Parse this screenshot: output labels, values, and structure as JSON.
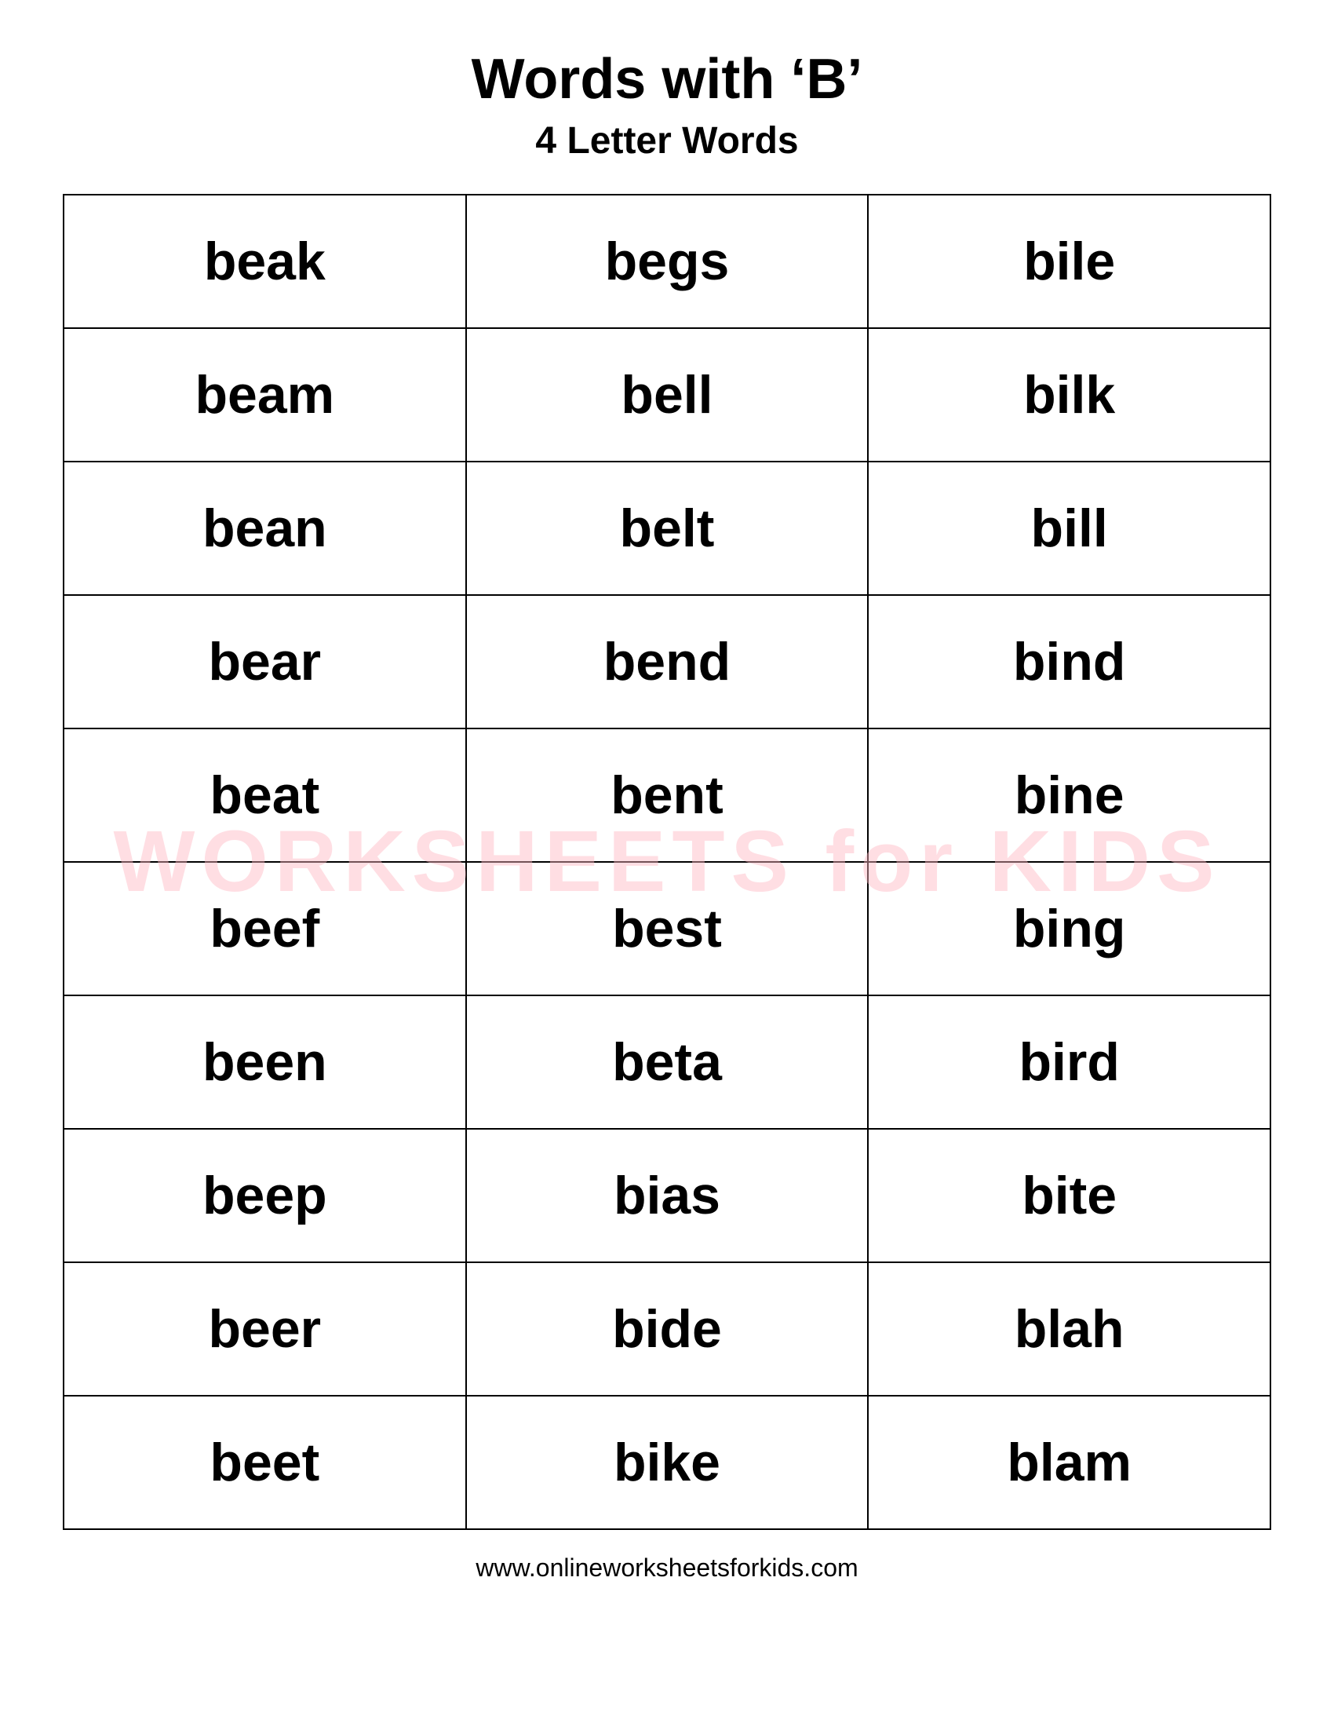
{
  "header": {
    "title": "Words with ‘B’",
    "subtitle": "4 Letter Words"
  },
  "watermark": {
    "line1": "WORKSHEETS for KIDS"
  },
  "table": {
    "rows": [
      [
        "beak",
        "begs",
        "bile"
      ],
      [
        "beam",
        "bell",
        "bilk"
      ],
      [
        "bean",
        "belt",
        "bill"
      ],
      [
        "bear",
        "bend",
        "bind"
      ],
      [
        "beat",
        "bent",
        "bine"
      ],
      [
        "beef",
        "best",
        "bing"
      ],
      [
        "been",
        "beta",
        "bird"
      ],
      [
        "beep",
        "bias",
        "bite"
      ],
      [
        "beer",
        "bide",
        "blah"
      ],
      [
        "beet",
        "bike",
        "blam"
      ]
    ]
  },
  "footer": {
    "url": "www.onlineworksheetsforkids.com"
  }
}
